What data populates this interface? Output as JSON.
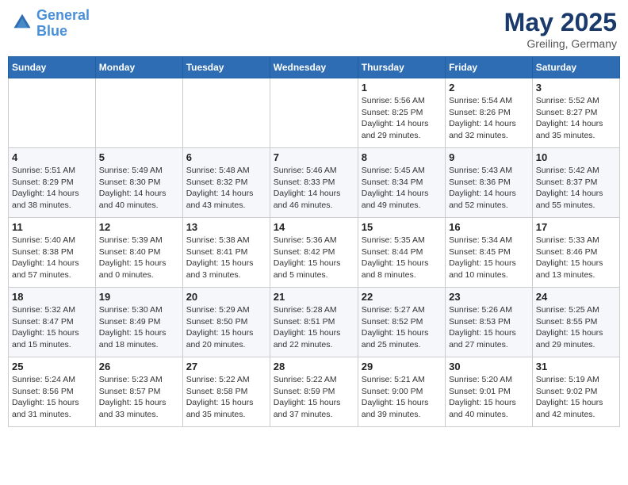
{
  "header": {
    "logo_line1": "General",
    "logo_line2": "Blue",
    "month": "May 2025",
    "location": "Greiling, Germany"
  },
  "days_of_week": [
    "Sunday",
    "Monday",
    "Tuesday",
    "Wednesday",
    "Thursday",
    "Friday",
    "Saturday"
  ],
  "weeks": [
    [
      {
        "day": "",
        "info": ""
      },
      {
        "day": "",
        "info": ""
      },
      {
        "day": "",
        "info": ""
      },
      {
        "day": "",
        "info": ""
      },
      {
        "day": "1",
        "info": "Sunrise: 5:56 AM\nSunset: 8:25 PM\nDaylight: 14 hours and 29 minutes."
      },
      {
        "day": "2",
        "info": "Sunrise: 5:54 AM\nSunset: 8:26 PM\nDaylight: 14 hours and 32 minutes."
      },
      {
        "day": "3",
        "info": "Sunrise: 5:52 AM\nSunset: 8:27 PM\nDaylight: 14 hours and 35 minutes."
      }
    ],
    [
      {
        "day": "4",
        "info": "Sunrise: 5:51 AM\nSunset: 8:29 PM\nDaylight: 14 hours and 38 minutes."
      },
      {
        "day": "5",
        "info": "Sunrise: 5:49 AM\nSunset: 8:30 PM\nDaylight: 14 hours and 40 minutes."
      },
      {
        "day": "6",
        "info": "Sunrise: 5:48 AM\nSunset: 8:32 PM\nDaylight: 14 hours and 43 minutes."
      },
      {
        "day": "7",
        "info": "Sunrise: 5:46 AM\nSunset: 8:33 PM\nDaylight: 14 hours and 46 minutes."
      },
      {
        "day": "8",
        "info": "Sunrise: 5:45 AM\nSunset: 8:34 PM\nDaylight: 14 hours and 49 minutes."
      },
      {
        "day": "9",
        "info": "Sunrise: 5:43 AM\nSunset: 8:36 PM\nDaylight: 14 hours and 52 minutes."
      },
      {
        "day": "10",
        "info": "Sunrise: 5:42 AM\nSunset: 8:37 PM\nDaylight: 14 hours and 55 minutes."
      }
    ],
    [
      {
        "day": "11",
        "info": "Sunrise: 5:40 AM\nSunset: 8:38 PM\nDaylight: 14 hours and 57 minutes."
      },
      {
        "day": "12",
        "info": "Sunrise: 5:39 AM\nSunset: 8:40 PM\nDaylight: 15 hours and 0 minutes."
      },
      {
        "day": "13",
        "info": "Sunrise: 5:38 AM\nSunset: 8:41 PM\nDaylight: 15 hours and 3 minutes."
      },
      {
        "day": "14",
        "info": "Sunrise: 5:36 AM\nSunset: 8:42 PM\nDaylight: 15 hours and 5 minutes."
      },
      {
        "day": "15",
        "info": "Sunrise: 5:35 AM\nSunset: 8:44 PM\nDaylight: 15 hours and 8 minutes."
      },
      {
        "day": "16",
        "info": "Sunrise: 5:34 AM\nSunset: 8:45 PM\nDaylight: 15 hours and 10 minutes."
      },
      {
        "day": "17",
        "info": "Sunrise: 5:33 AM\nSunset: 8:46 PM\nDaylight: 15 hours and 13 minutes."
      }
    ],
    [
      {
        "day": "18",
        "info": "Sunrise: 5:32 AM\nSunset: 8:47 PM\nDaylight: 15 hours and 15 minutes."
      },
      {
        "day": "19",
        "info": "Sunrise: 5:30 AM\nSunset: 8:49 PM\nDaylight: 15 hours and 18 minutes."
      },
      {
        "day": "20",
        "info": "Sunrise: 5:29 AM\nSunset: 8:50 PM\nDaylight: 15 hours and 20 minutes."
      },
      {
        "day": "21",
        "info": "Sunrise: 5:28 AM\nSunset: 8:51 PM\nDaylight: 15 hours and 22 minutes."
      },
      {
        "day": "22",
        "info": "Sunrise: 5:27 AM\nSunset: 8:52 PM\nDaylight: 15 hours and 25 minutes."
      },
      {
        "day": "23",
        "info": "Sunrise: 5:26 AM\nSunset: 8:53 PM\nDaylight: 15 hours and 27 minutes."
      },
      {
        "day": "24",
        "info": "Sunrise: 5:25 AM\nSunset: 8:55 PM\nDaylight: 15 hours and 29 minutes."
      }
    ],
    [
      {
        "day": "25",
        "info": "Sunrise: 5:24 AM\nSunset: 8:56 PM\nDaylight: 15 hours and 31 minutes."
      },
      {
        "day": "26",
        "info": "Sunrise: 5:23 AM\nSunset: 8:57 PM\nDaylight: 15 hours and 33 minutes."
      },
      {
        "day": "27",
        "info": "Sunrise: 5:22 AM\nSunset: 8:58 PM\nDaylight: 15 hours and 35 minutes."
      },
      {
        "day": "28",
        "info": "Sunrise: 5:22 AM\nSunset: 8:59 PM\nDaylight: 15 hours and 37 minutes."
      },
      {
        "day": "29",
        "info": "Sunrise: 5:21 AM\nSunset: 9:00 PM\nDaylight: 15 hours and 39 minutes."
      },
      {
        "day": "30",
        "info": "Sunrise: 5:20 AM\nSunset: 9:01 PM\nDaylight: 15 hours and 40 minutes."
      },
      {
        "day": "31",
        "info": "Sunrise: 5:19 AM\nSunset: 9:02 PM\nDaylight: 15 hours and 42 minutes."
      }
    ]
  ]
}
